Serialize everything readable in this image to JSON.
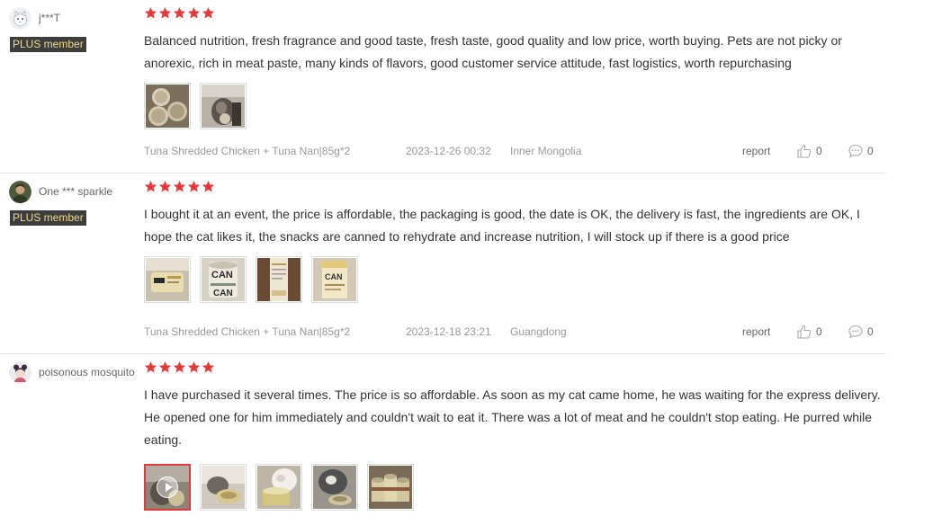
{
  "reviews": [
    {
      "username": "j***T",
      "plus_label": "PLUS member",
      "avatar": "cat-avatar-icon",
      "rating": 5,
      "text": "Balanced nutrition, fresh fragrance and good taste, fresh taste, good quality and low price, worth buying. Pets are not picky or anorexic, rich in meat paste, many kinds of flavors, good customer service attitude, fast logistics, worth repurchasing",
      "thumbs": [
        "photo-cans-stacked",
        "photo-cat-eating"
      ],
      "variant": "Tuna Shredded Chicken + Tuna Nan|85g*2",
      "date": "2023-12-26 00:32",
      "region": "Inner Mongolia",
      "report_label": "report",
      "likes": "0",
      "replies": "0"
    },
    {
      "username": "One *** sparkle",
      "plus_label": "PLUS member",
      "avatar": "photo-avatar-icon",
      "rating": 5,
      "text": "I bought it at an event, the price is affordable, the packaging is good, the date is OK, the delivery is fast, the ingredients are OK, I hope the cat likes it, the snacks are canned to rehydrate and increase nutrition, I will stock up if there is a good price",
      "thumbs": [
        "photo-can-label",
        "photo-can-top",
        "photo-box-side",
        "photo-box-front"
      ],
      "variant": "Tuna Shredded Chicken + Tuna Nan|85g*2",
      "date": "2023-12-18 23:21",
      "region": "Guangdong",
      "report_label": "report",
      "likes": "0",
      "replies": "0"
    },
    {
      "username": "poisonous mosquito",
      "plus_label": "",
      "avatar": "girl-avatar-icon",
      "rating": 5,
      "text": "I have purchased it several times. The price is so affordable. As soon as my cat came home, he was waiting for the express delivery. He opened one for him immediately and couldn't wait to eat it. There was a lot of meat and he couldn't stop eating. He purred while eating.",
      "thumbs": [
        "video-cat-eating",
        "photo-cat-bowl",
        "photo-cat-can",
        "photo-cat-closeup",
        "photo-cans-group"
      ],
      "variant": "",
      "date": "",
      "region": "",
      "report_label": "",
      "likes": "",
      "replies": ""
    }
  ],
  "colors": {
    "star": "#e4393c",
    "plus_badge_bg": "#3d3d3d",
    "plus_badge_text": "#f2d98a",
    "meta_text": "#999999",
    "active_thumb_border": "#e4393c"
  }
}
